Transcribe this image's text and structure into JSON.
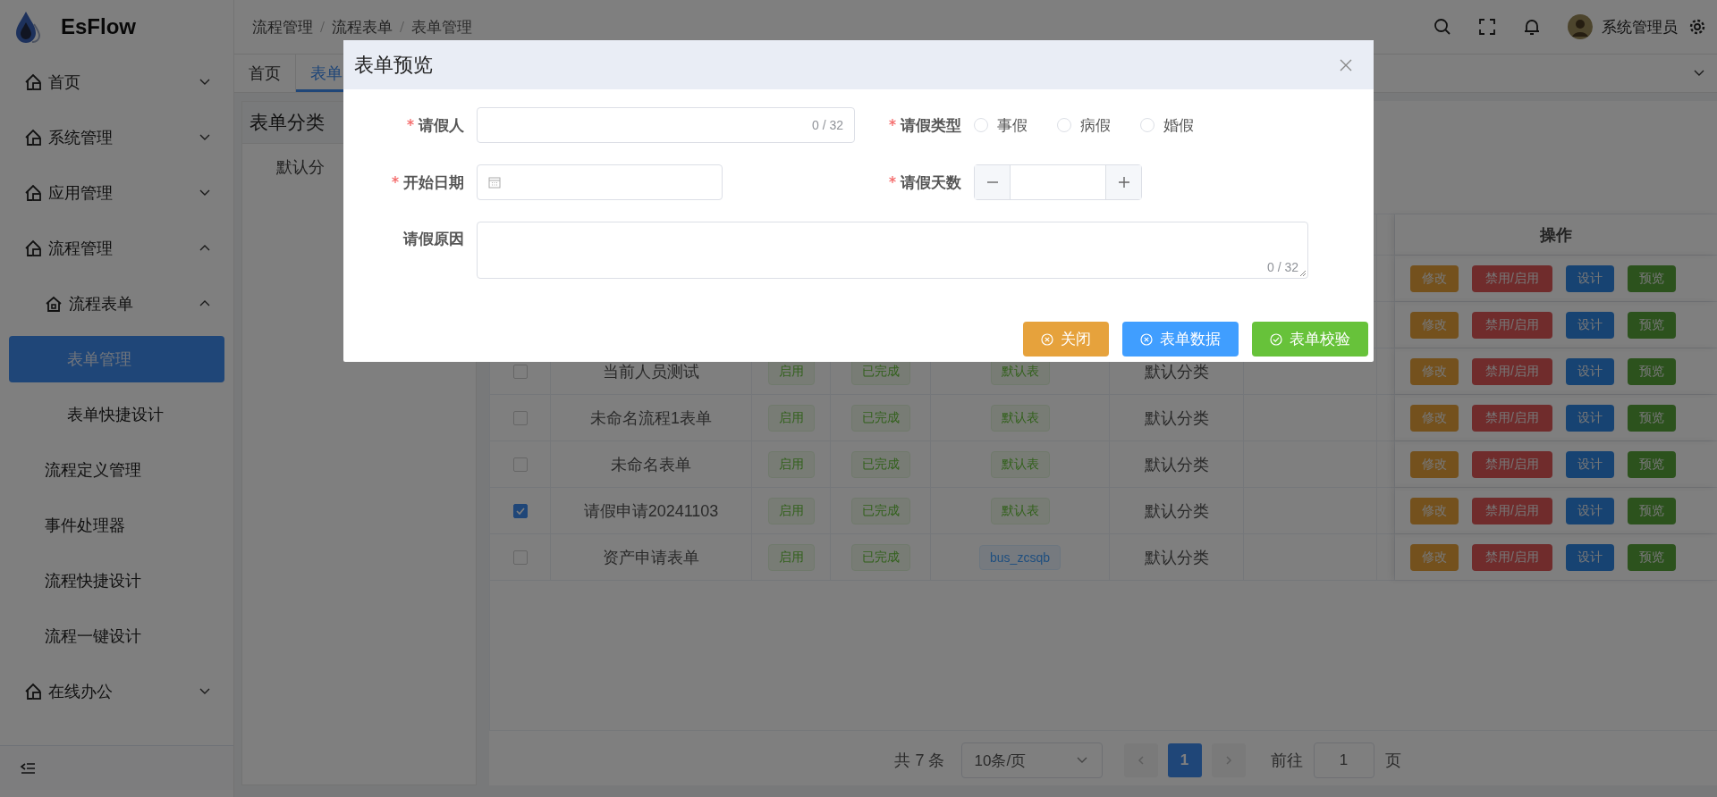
{
  "app": {
    "name": "EsFlow"
  },
  "sidebar": {
    "items": [
      {
        "label": "首页",
        "expanded": false
      },
      {
        "label": "系统管理",
        "expanded": false
      },
      {
        "label": "应用管理",
        "expanded": false
      },
      {
        "label": "流程管理",
        "expanded": true,
        "children": [
          {
            "label": "流程表单",
            "expanded": true,
            "children": [
              {
                "label": "表单管理",
                "selected": true
              },
              {
                "label": "表单快捷设计",
                "selected": false
              }
            ]
          },
          {
            "label": "流程定义管理",
            "selected": false
          },
          {
            "label": "事件处理器",
            "selected": false
          },
          {
            "label": "流程快捷设计",
            "selected": false
          },
          {
            "label": "流程一键设计",
            "selected": false
          }
        ]
      },
      {
        "label": "在线办公",
        "expanded": false
      }
    ]
  },
  "header": {
    "breadcrumb": [
      "流程管理",
      "流程表单",
      "表单管理"
    ],
    "user": "系统管理员"
  },
  "tabs": [
    {
      "label": "首页",
      "selected": false
    },
    {
      "label": "表单",
      "selected": true
    }
  ],
  "category_panel": {
    "title": "表单分类",
    "items": [
      "默认分"
    ]
  },
  "table": {
    "action_column_title": "操作",
    "rows": [
      {
        "actions": [
          {
            "label": "修改",
            "kind": "edit"
          },
          {
            "label": "禁用/启用",
            "kind": "toggle"
          },
          {
            "label": "设计",
            "kind": "design"
          },
          {
            "label": "预览",
            "kind": "preview"
          }
        ]
      },
      {
        "actions": [
          {
            "label": "修改",
            "kind": "edit"
          },
          {
            "label": "禁用/启用",
            "kind": "toggle"
          },
          {
            "label": "设计",
            "kind": "design"
          },
          {
            "label": "预览",
            "kind": "preview"
          }
        ]
      },
      {
        "checked": false,
        "name": "当前人员测试",
        "tags": [
          {
            "label": "启用",
            "kind": "success"
          },
          {
            "label": "已完成",
            "kind": "success"
          },
          {
            "label": "默认表",
            "kind": "success"
          }
        ],
        "category": "默认分类",
        "actions": [
          {
            "label": "修改",
            "kind": "edit"
          },
          {
            "label": "禁用/启用",
            "kind": "toggle"
          },
          {
            "label": "设计",
            "kind": "design"
          },
          {
            "label": "预览",
            "kind": "preview"
          }
        ]
      },
      {
        "checked": false,
        "name": "未命名流程1表单",
        "tags": [
          {
            "label": "启用",
            "kind": "success"
          },
          {
            "label": "已完成",
            "kind": "success"
          },
          {
            "label": "默认表",
            "kind": "success"
          }
        ],
        "category": "默认分类",
        "actions": [
          {
            "label": "修改",
            "kind": "edit"
          },
          {
            "label": "禁用/启用",
            "kind": "toggle"
          },
          {
            "label": "设计",
            "kind": "design"
          },
          {
            "label": "预览",
            "kind": "preview"
          }
        ]
      },
      {
        "checked": false,
        "name": "未命名表单",
        "tags": [
          {
            "label": "启用",
            "kind": "success"
          },
          {
            "label": "已完成",
            "kind": "success"
          },
          {
            "label": "默认表",
            "kind": "success"
          }
        ],
        "category": "默认分类",
        "actions": [
          {
            "label": "修改",
            "kind": "edit"
          },
          {
            "label": "禁用/启用",
            "kind": "toggle"
          },
          {
            "label": "设计",
            "kind": "design"
          },
          {
            "label": "预览",
            "kind": "preview"
          }
        ]
      },
      {
        "checked": true,
        "name": "请假申请20241103",
        "tags": [
          {
            "label": "启用",
            "kind": "success"
          },
          {
            "label": "已完成",
            "kind": "success"
          },
          {
            "label": "默认表",
            "kind": "success"
          }
        ],
        "category": "默认分类",
        "actions": [
          {
            "label": "修改",
            "kind": "edit"
          },
          {
            "label": "禁用/启用",
            "kind": "toggle"
          },
          {
            "label": "设计",
            "kind": "design"
          },
          {
            "label": "预览",
            "kind": "preview"
          }
        ]
      },
      {
        "checked": false,
        "name": "资产申请表单",
        "tags": [
          {
            "label": "启用",
            "kind": "success"
          },
          {
            "label": "已完成",
            "kind": "success"
          },
          {
            "label": "bus_zcsqb",
            "kind": "primary"
          }
        ],
        "category": "默认分类",
        "actions": [
          {
            "label": "修改",
            "kind": "edit"
          },
          {
            "label": "禁用/启用",
            "kind": "toggle"
          },
          {
            "label": "设计",
            "kind": "design"
          },
          {
            "label": "预览",
            "kind": "preview"
          }
        ]
      }
    ]
  },
  "pagination": {
    "total": "共 7 条",
    "page_size": "10条/页",
    "pages": [
      {
        "label": "1",
        "selected": true
      }
    ],
    "goto_label": "前往",
    "goto_value": "1",
    "page_unit": "页"
  },
  "modal": {
    "title": "表单预览",
    "fields": [
      {
        "kind": "text",
        "label": "请假人",
        "required": true,
        "counter": "0 / 32"
      },
      {
        "kind": "radio",
        "label": "请假类型",
        "required": true,
        "options": [
          {
            "label": "事假",
            "selected": false
          },
          {
            "label": "病假",
            "selected": false
          },
          {
            "label": "婚假",
            "selected": false
          }
        ]
      },
      {
        "kind": "date",
        "label": "开始日期",
        "required": true
      },
      {
        "kind": "number",
        "label": "请假天数",
        "required": true
      },
      {
        "kind": "textarea",
        "label": "请假原因",
        "required": false,
        "counter": "0 / 32"
      }
    ],
    "buttons": [
      {
        "label": "关闭",
        "kind": "close"
      },
      {
        "label": "表单数据",
        "kind": "data"
      },
      {
        "label": "表单校验",
        "kind": "validate"
      }
    ]
  }
}
